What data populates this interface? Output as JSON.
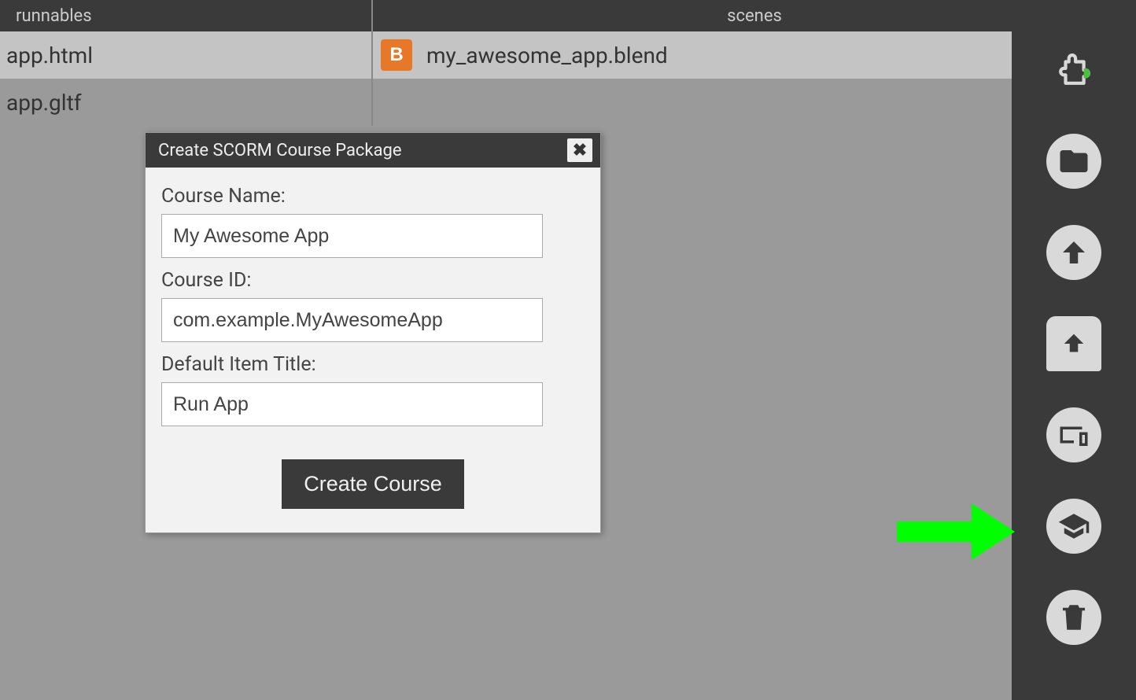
{
  "header": {
    "runnables_label": "runnables",
    "scenes_label": "scenes"
  },
  "files": {
    "runnables": [
      {
        "name": "app.html"
      },
      {
        "name": "app.gltf"
      }
    ],
    "scenes": [
      {
        "name": "my_awesome_app.blend",
        "icon_letter": "B"
      }
    ]
  },
  "dialog": {
    "title": "Create SCORM Course Package",
    "close_glyph": "✖",
    "course_name_label": "Course Name:",
    "course_name_value": "My Awesome App",
    "course_id_label": "Course ID:",
    "course_id_value": "com.example.MyAwesomeApp",
    "default_item_title_label": "Default Item Title:",
    "default_item_title_value": "Run App",
    "submit_label": "Create Course"
  },
  "sidebar": {
    "puzzle_icon": "puzzle-icon",
    "folder_icon": "folder-icon",
    "upload_icon": "upload-arrow-icon",
    "publish_icon": "publish-icon",
    "devices_icon": "devices-icon",
    "scorm_icon": "graduation-cap-icon",
    "trash_icon": "trash-icon"
  }
}
